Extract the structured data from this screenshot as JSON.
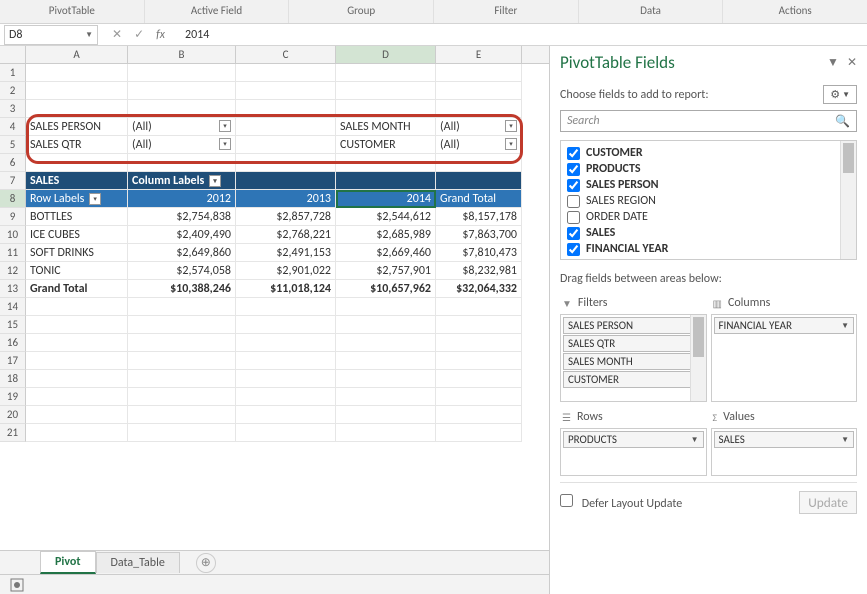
{
  "ribbon": {
    "groups": [
      "PivotTable",
      "Active Field",
      "Group",
      "Filter",
      "Data",
      "Actions"
    ]
  },
  "formula_bar": {
    "name_box": "D8",
    "value": "2014"
  },
  "columns": [
    "A",
    "B",
    "C",
    "D",
    "E"
  ],
  "row_numbers": [
    1,
    2,
    3,
    4,
    5,
    6,
    7,
    8,
    9,
    10,
    11,
    12,
    13,
    14,
    15,
    16,
    17,
    18,
    19,
    20,
    21
  ],
  "report_filters": [
    {
      "label": "SALES PERSON",
      "value": "(All)",
      "col_label_pos": "A",
      "col_val_pos": "B",
      "row": 4
    },
    {
      "label": "SALES QTR",
      "value": "(All)",
      "col_label_pos": "A",
      "col_val_pos": "B",
      "row": 5
    },
    {
      "label": "SALES MONTH",
      "value": "(All)",
      "col_label_pos": "D",
      "col_val_pos": "E",
      "row": 4
    },
    {
      "label": "CUSTOMER",
      "value": "(All)",
      "col_label_pos": "D",
      "col_val_pos": "E",
      "row": 5
    }
  ],
  "pivot": {
    "title": "SALES",
    "col_labels_caption": "Column Labels",
    "row_labels_caption": "Row Labels",
    "col_headers": [
      "2012",
      "2013",
      "2014"
    ],
    "grand_total_label": "Grand Total",
    "rows": [
      {
        "label": "BOTTLES",
        "v": [
          "$2,754,838",
          "$2,857,728",
          "$2,544,612",
          "$8,157,178"
        ]
      },
      {
        "label": "ICE CUBES",
        "v": [
          "$2,409,490",
          "$2,768,221",
          "$2,685,989",
          "$7,863,700"
        ]
      },
      {
        "label": "SOFT DRINKS",
        "v": [
          "$2,649,860",
          "$2,491,153",
          "$2,669,460",
          "$7,810,473"
        ]
      },
      {
        "label": "TONIC",
        "v": [
          "$2,574,058",
          "$2,901,022",
          "$2,757,901",
          "$8,232,981"
        ]
      }
    ],
    "grand": [
      "$10,388,246",
      "$11,018,124",
      "$10,657,962",
      "$32,064,332"
    ]
  },
  "tabs": {
    "active": "Pivot",
    "items": [
      "Pivot",
      "Data_Table"
    ]
  },
  "pane": {
    "title": "PivotTable Fields",
    "subtitle": "Choose fields to add to report:",
    "search_placeholder": "Search",
    "fields": [
      {
        "name": "CUSTOMER",
        "checked": true
      },
      {
        "name": "PRODUCTS",
        "checked": true
      },
      {
        "name": "SALES PERSON",
        "checked": true
      },
      {
        "name": "SALES REGION",
        "checked": false
      },
      {
        "name": "ORDER DATE",
        "checked": false
      },
      {
        "name": "SALES",
        "checked": true
      },
      {
        "name": "FINANCIAL YEAR",
        "checked": true
      }
    ],
    "drag_hint": "Drag fields between areas below:",
    "areas": {
      "filters_label": "Filters",
      "columns_label": "Columns",
      "rows_label": "Rows",
      "values_label": "Values",
      "filters": [
        "SALES PERSON",
        "SALES QTR",
        "SALES MONTH",
        "CUSTOMER"
      ],
      "columns": [
        "FINANCIAL YEAR"
      ],
      "rows": [
        "PRODUCTS"
      ],
      "values": [
        "SALES"
      ]
    },
    "defer_label": "Defer Layout Update",
    "update_label": "Update"
  }
}
